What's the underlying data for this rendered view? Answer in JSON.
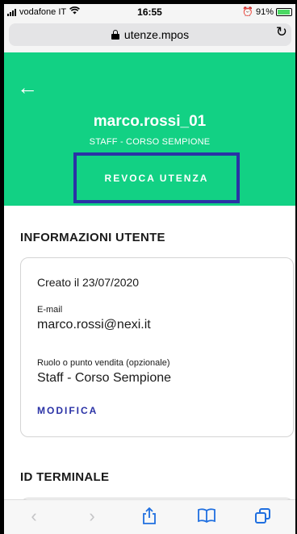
{
  "status_bar": {
    "carrier": "vodafone IT",
    "time": "16:55",
    "battery": "91%",
    "battery_level": 0.91
  },
  "address_bar": {
    "url": "utenze.mpos"
  },
  "header": {
    "username": "marco.rossi_01",
    "role": "STAFF - CORSO SEMPIONE",
    "revoke_label": "REVOCA UTENZA"
  },
  "user_info": {
    "title": "INFORMAZIONI UTENTE",
    "created": "Creato il 23/07/2020",
    "email_label": "E-mail",
    "email_value": "marco.rossi@nexi.it",
    "role_label": "Ruolo o punto vendita (opzionale)",
    "role_value": "Staff - Corso Sempione",
    "edit_label": "MODIFICA"
  },
  "terminal": {
    "title": "ID TERMINALE"
  },
  "colors": {
    "header_green": "#12d184",
    "accent_blue": "#2a32a6",
    "safari_blue": "#1f6fe0"
  },
  "toolbar": {
    "icons": [
      "back-icon",
      "forward-icon",
      "share-icon",
      "bookmarks-icon",
      "tabs-icon"
    ]
  }
}
